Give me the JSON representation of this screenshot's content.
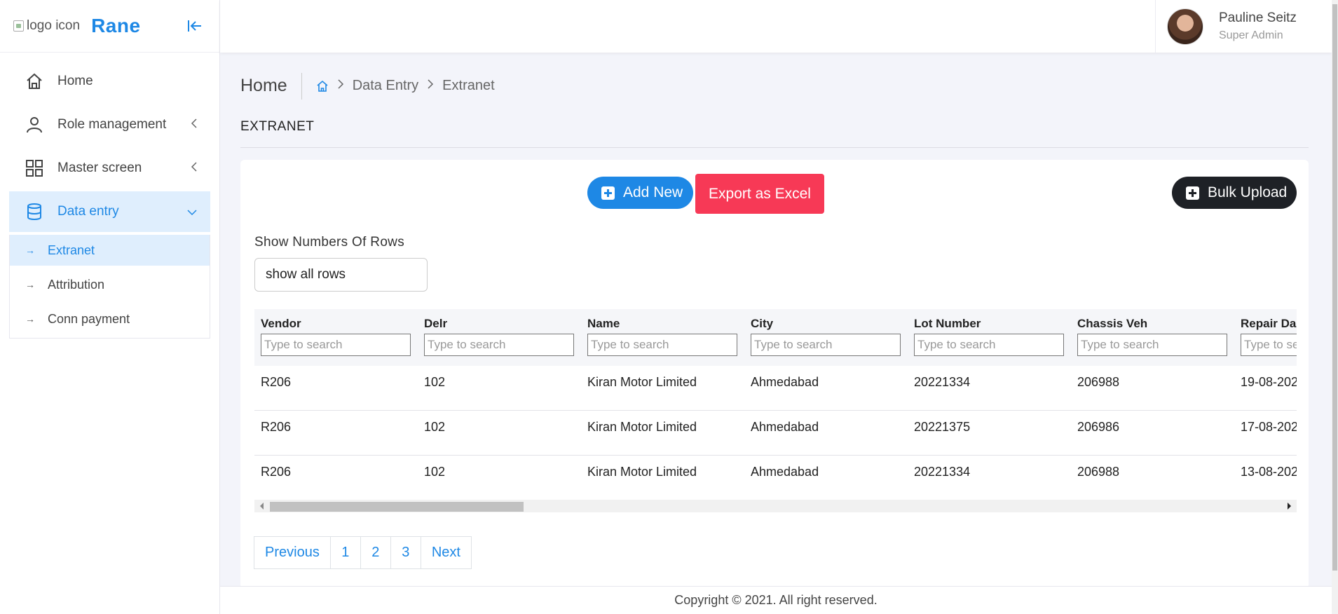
{
  "sidebar": {
    "logo_alt": "logo icon",
    "brand": "Rane",
    "items": [
      {
        "label": "Home"
      },
      {
        "label": "Role management"
      },
      {
        "label": "Master screen"
      },
      {
        "label": "Data entry"
      }
    ],
    "sub_items": [
      {
        "label": "Extranet"
      },
      {
        "label": "Attribution"
      },
      {
        "label": "Conn payment"
      }
    ]
  },
  "user": {
    "name": "Pauline Seitz",
    "role": "Super Admin"
  },
  "breadcrumb": {
    "title": "Home",
    "items": [
      "Data Entry",
      "Extranet"
    ]
  },
  "page": {
    "heading": "EXTRANET"
  },
  "toolbar": {
    "add_label": "Add New",
    "export_label": "Export as Excel",
    "bulk_label": "Bulk Upload"
  },
  "rows_control": {
    "label": "Show Numbers Of Rows",
    "value": "show all rows"
  },
  "table": {
    "search_placeholder": "Type to search",
    "columns": [
      "Vendor",
      "Delr",
      "Name",
      "City",
      "Lot Number",
      "Chassis Veh",
      "Repair Da"
    ],
    "rows": [
      [
        "R206",
        "102",
        "Kiran Motor Limited",
        "Ahmedabad",
        "20221334",
        "206988",
        "19-08-202"
      ],
      [
        "R206",
        "102",
        "Kiran Motor Limited",
        "Ahmedabad",
        "20221375",
        "206986",
        "17-08-202"
      ],
      [
        "R206",
        "102",
        "Kiran Motor Limited",
        "Ahmedabad",
        "20221334",
        "206988",
        "13-08-202"
      ]
    ]
  },
  "pagination": {
    "previous": "Previous",
    "pages": [
      "1",
      "2",
      "3"
    ],
    "next": "Next"
  },
  "footer": {
    "text": "Copyright © 2021. All right reserved."
  },
  "colors": {
    "accent": "#1e88e5",
    "export": "#f73956",
    "dark": "#1e2126"
  }
}
